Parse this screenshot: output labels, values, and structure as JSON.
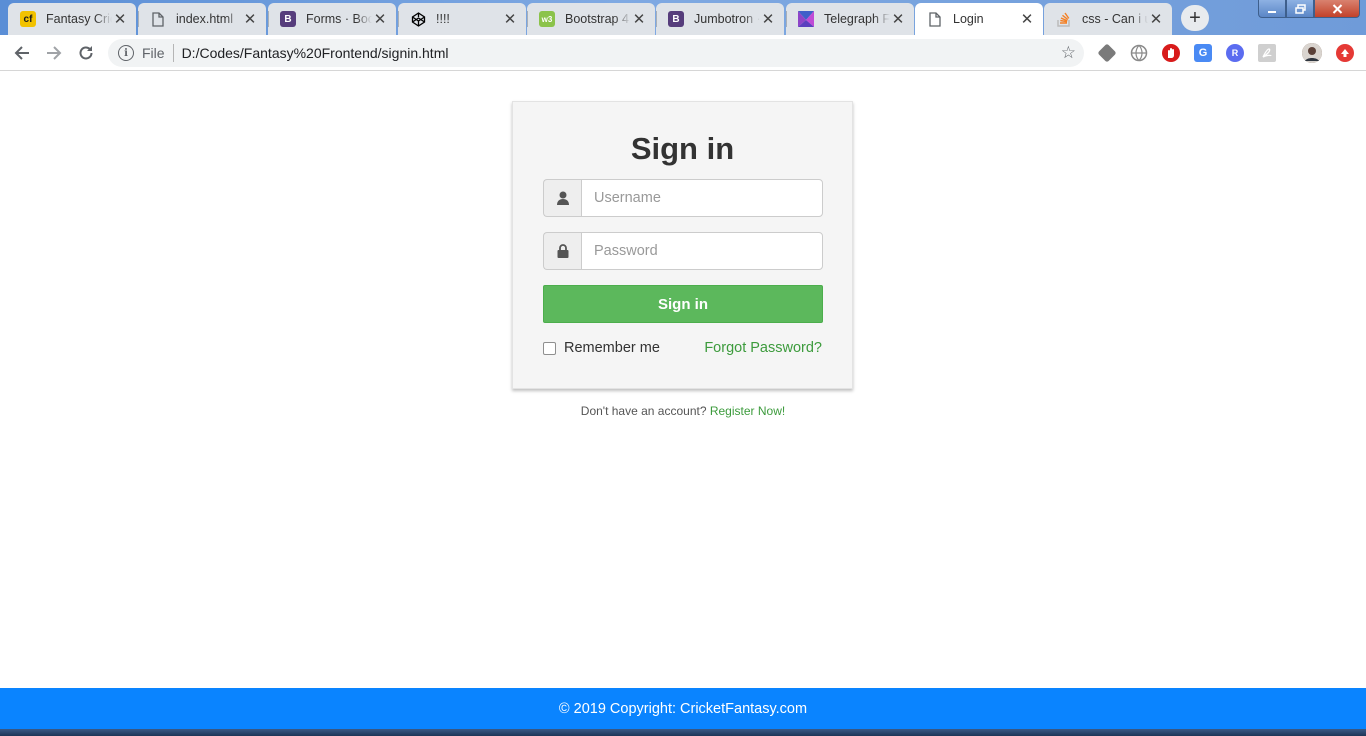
{
  "browser": {
    "tabs": [
      {
        "title": "Fantasy Cricket",
        "icon": "cricket-icon",
        "color": "#f2c200"
      },
      {
        "title": "index.html",
        "icon": "file-icon",
        "color": "#5f6368"
      },
      {
        "title": "Forms · Bootstrap",
        "icon": "bootstrap-icon",
        "color": "#563d7c"
      },
      {
        "title": "!!!!",
        "icon": "codepen-icon",
        "color": "#000000"
      },
      {
        "title": "Bootstrap 4",
        "icon": "w3schools-icon",
        "color": "#8bc34a"
      },
      {
        "title": "Jumbotron · Bootstrap",
        "icon": "bootstrap-icon",
        "color": "#563d7c"
      },
      {
        "title": "Telegraph Font",
        "icon": "telegraph-icon",
        "color": "#7b3fbf"
      },
      {
        "title": "Login",
        "icon": "file-icon",
        "color": "#5f6368"
      },
      {
        "title": "css - Can i use",
        "icon": "stackoverflow-icon",
        "color": "#f48024"
      }
    ],
    "new_tab": "+",
    "close_glyph": "✕",
    "omnibox": {
      "scheme_label": "File",
      "url": "D:/Codes/Fantasy%20Frontend/signin.html"
    }
  },
  "page": {
    "title": "Sign in",
    "username_placeholder": "Username",
    "password_placeholder": "Password",
    "signin_button": "Sign in",
    "remember_label": "Remember me",
    "forgot_link": "Forgot Password?",
    "no_account_text": "Don't have an account?",
    "register_link": "Register Now!",
    "accent_color": "#5cb85c"
  },
  "footer": {
    "text": "© 2019 Copyright: CricketFantasy.com",
    "color": "#0a84ff"
  }
}
